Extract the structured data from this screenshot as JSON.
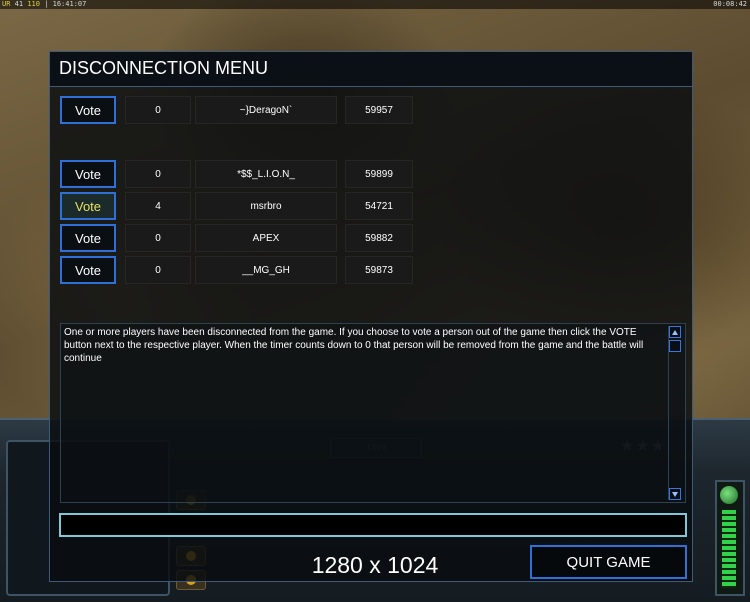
{
  "hud": {
    "ur_label": "UR",
    "ur_value": "41",
    "fps_value": "110",
    "fps_sep": "|",
    "clock": "16:41:07",
    "timer": "00:08:42"
  },
  "controlbar": {
    "mid_label": "1399"
  },
  "panel": {
    "title": "DISCONNECTION MENU",
    "local_row": {
      "vote_label": "Vote",
      "count": "0",
      "name": "~}DeragoN`",
      "number": "59957"
    },
    "players": [
      {
        "vote_label": "Vote",
        "count": "0",
        "name": "*$$_L.I.O.N_",
        "number": "59899",
        "highlighted": false
      },
      {
        "vote_label": "Vote",
        "count": "4",
        "name": "msrbro",
        "number": "54721",
        "highlighted": true
      },
      {
        "vote_label": "Vote",
        "count": "0",
        "name": "APEX",
        "number": "59882",
        "highlighted": false
      },
      {
        "vote_label": "Vote",
        "count": "0",
        "name": "__MG_GH",
        "number": "59873",
        "highlighted": false
      }
    ],
    "message": "One or more players have been disconnected from the game. If you choose to vote a person out of the game then click the VOTE button next to the respective player. When the timer counts down to 0 that person will be removed from the game and the battle will continue",
    "chat_value": "",
    "resolution": "1280 x 1024",
    "quit_label": "QUIT GAME"
  },
  "colors": {
    "button_border": "#2f6fd8",
    "panel_border": "#3e5a78",
    "chat_border": "#7fc8d8",
    "highlight_text": "#e8e060"
  }
}
